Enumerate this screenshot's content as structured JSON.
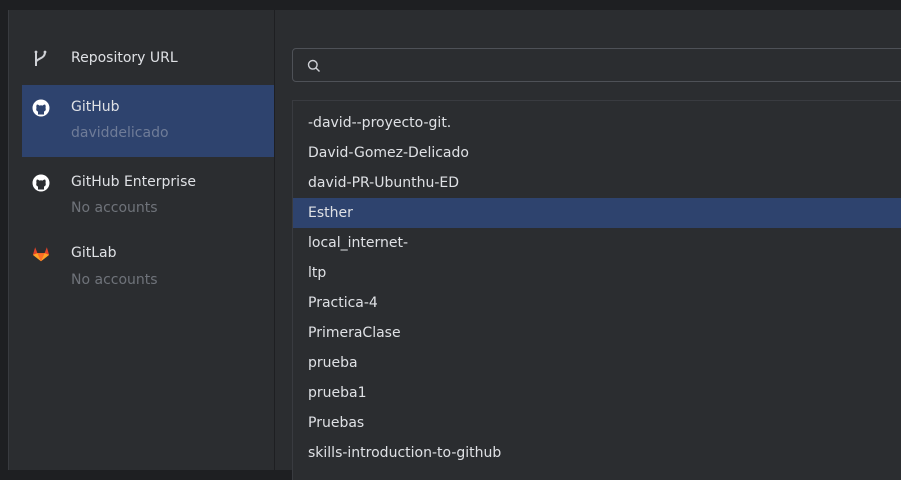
{
  "sidebar": {
    "items": [
      {
        "title": "Repository URL",
        "subtitle": "",
        "icon": "branch-icon",
        "selected": false
      },
      {
        "title": "GitHub",
        "subtitle": "daviddelicado",
        "icon": "github-icon",
        "selected": true
      },
      {
        "title": "GitHub Enterprise",
        "subtitle": "No accounts",
        "icon": "github-icon",
        "selected": false
      },
      {
        "title": "GitLab",
        "subtitle": "No accounts",
        "icon": "gitlab-icon",
        "selected": false
      }
    ]
  },
  "search": {
    "placeholder": "",
    "value": "",
    "icon": "search-icon"
  },
  "repositories": {
    "selected": "Esther",
    "items": [
      "-david--proyecto-git.",
      "David-Gomez-Delicado",
      "david-PR-Ubunthu-ED",
      "Esther",
      "local_internet-",
      "ltp",
      "Practica-4",
      "PrimeraClase",
      "prueba",
      "prueba1",
      "Pruebas",
      "skills-introduction-to-github"
    ]
  },
  "colors": {
    "background": "#1e1f22",
    "panel": "#2b2d30",
    "selection": "#2e436e",
    "text": "#dfe1e5",
    "muted": "#6f737a",
    "gitlab": "#e24329"
  }
}
